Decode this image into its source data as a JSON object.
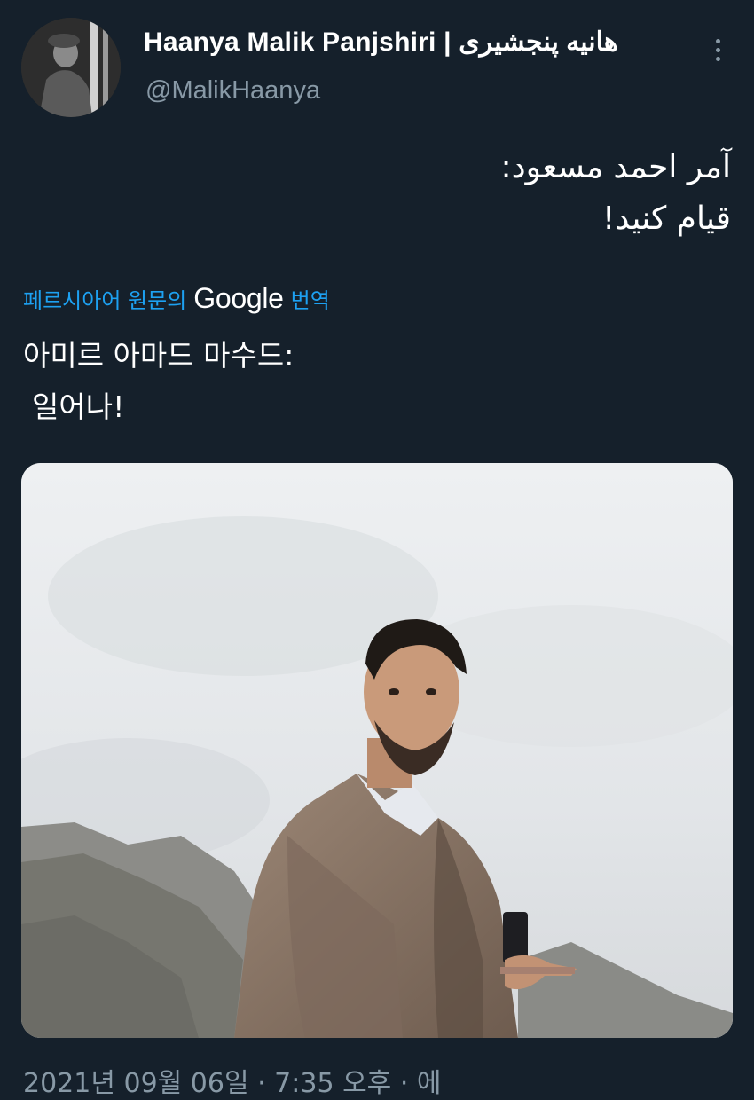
{
  "author": {
    "display_name": "Haanya Malik Panjshiri | هانیه پنجشیری",
    "handle": "@MalikHaanya"
  },
  "tweet": {
    "original_text_line1": "آمر احمد مسعود:",
    "original_text_line2": "قیام کنید!",
    "translation_label_prefix": "페르시아어 원문의",
    "translation_label_brand": "Google",
    "translation_label_suffix": "번역",
    "translated_text_line1": "아미르 아마드 마수드:",
    "translated_text_line2": "일어나!",
    "timestamp": "2021년 09월 06일 · 7:35 오후 · 에"
  },
  "icons": {
    "more": "more-vertical-icon"
  },
  "colors": {
    "background": "#15202b",
    "secondary_text": "#8899a6",
    "link": "#1da1f2"
  }
}
